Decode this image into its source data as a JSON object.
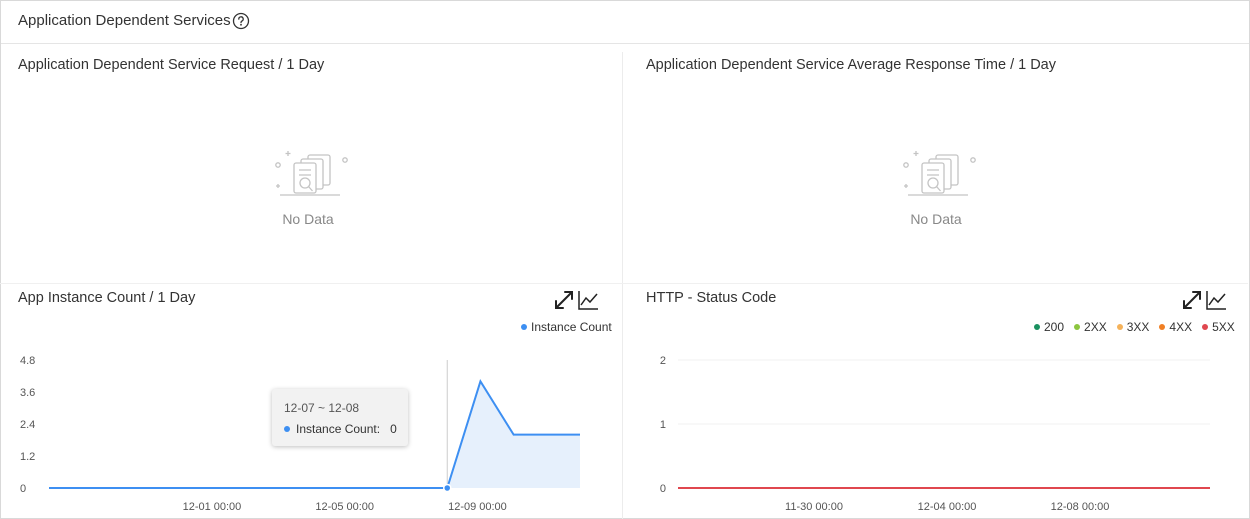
{
  "header": {
    "title": "Application Dependent Services"
  },
  "panels": {
    "requests": {
      "title": "Application Dependent Service Request / 1 Day",
      "empty_text": "No Data"
    },
    "response_time": {
      "title": "Application Dependent Service Average Response Time / 1 Day",
      "empty_text": "No Data"
    },
    "instance_count": {
      "title": "App Instance Count / 1 Day",
      "legend": [
        {
          "label": "Instance Count",
          "color": "#3d8ff2"
        }
      ],
      "tooltip": {
        "title": "12-07 ~ 12-08",
        "label": "Instance Count:",
        "value": "0"
      }
    },
    "http_status": {
      "title": "HTTP - Status Code",
      "legend": [
        {
          "label": "200",
          "color": "#1a9160"
        },
        {
          "label": "2XX",
          "color": "#8cc63f"
        },
        {
          "label": "3XX",
          "color": "#f5b25a"
        },
        {
          "label": "4XX",
          "color": "#f07f24"
        },
        {
          "label": "5XX",
          "color": "#e0474f"
        }
      ]
    }
  },
  "chart_data": [
    {
      "type": "area",
      "series": [
        {
          "name": "Instance Count",
          "values": [
            0,
            0,
            0,
            0,
            0,
            0,
            0,
            0,
            0,
            0,
            0,
            0,
            0,
            4,
            2,
            2,
            2
          ]
        }
      ],
      "x": [
        "11-26",
        "11-27",
        "11-28",
        "11-29",
        "11-30",
        "12-01",
        "12-02",
        "12-03",
        "12-04",
        "12-05",
        "12-06",
        "12-07",
        "12-08",
        "12-09",
        "12-10",
        "12-11",
        "12-12"
      ],
      "x_tick_labels": [
        "12-01 00:00",
        "12-05 00:00",
        "12-09 00:00"
      ],
      "y_tick_labels": [
        "4.8",
        "3.6",
        "2.4",
        "1.2",
        "0"
      ],
      "ylim": [
        0,
        4.8
      ],
      "grid": false,
      "legend_position": "top-right"
    },
    {
      "type": "line",
      "series": [
        {
          "name": "5XX",
          "values": [
            0,
            0,
            0,
            0,
            0,
            0,
            0,
            0,
            0,
            0,
            0,
            0,
            0,
            0,
            0,
            0,
            0
          ]
        }
      ],
      "x": [
        "11-26",
        "11-27",
        "11-28",
        "11-29",
        "11-30",
        "12-01",
        "12-02",
        "12-03",
        "12-04",
        "12-05",
        "12-06",
        "12-07",
        "12-08",
        "12-09",
        "12-10",
        "12-11",
        "12-12"
      ],
      "x_tick_labels": [
        "11-30 00:00",
        "12-04 00:00",
        "12-08 00:00"
      ],
      "y_tick_labels": [
        "2",
        "1",
        "0"
      ],
      "ylim": [
        0,
        2
      ],
      "grid": true,
      "legend_position": "top-right"
    }
  ]
}
